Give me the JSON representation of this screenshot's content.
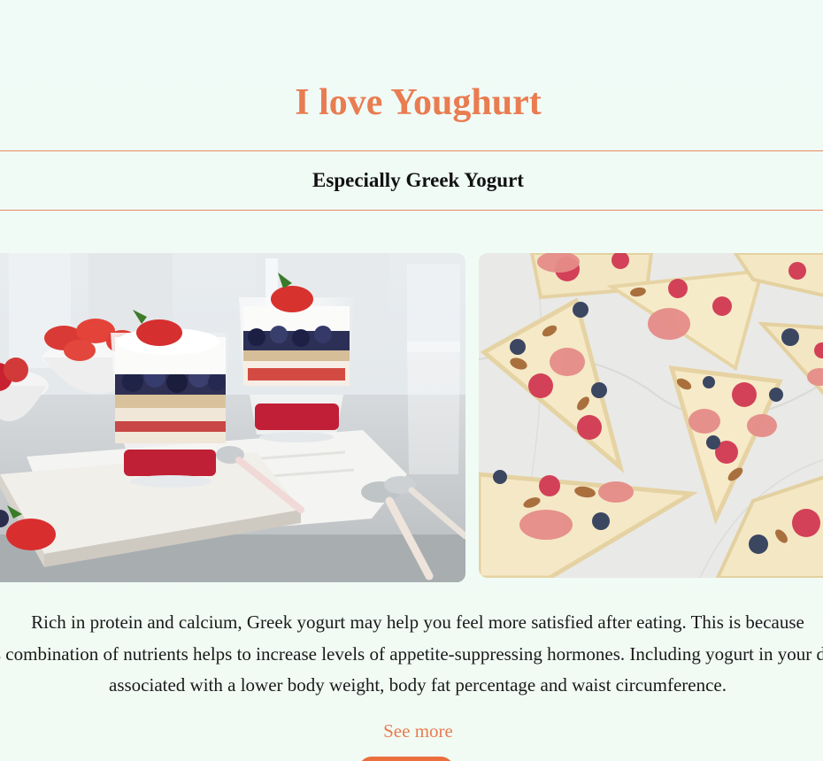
{
  "header": {
    "title": "I love Youghurt",
    "subtitle": "Especially Greek Yogurt"
  },
  "images": [
    {
      "name": "yogurt-parfait-photo",
      "alt": "Yogurt parfait glasses with berries and granola"
    },
    {
      "name": "frozen-yogurt-bark-photo",
      "alt": "Frozen yogurt bark slices with berries and almonds"
    }
  ],
  "article": {
    "lines": [
      "Rich in protein and calcium, Greek yogurt may help you feel more satisfied after eating. This is because",
      "this combination of nutrients helps to increase levels of appetite-suppressing hormones. Including yogurt in your diet is",
      "associated with a lower body weight, body fat percentage and waist circumference."
    ],
    "see_more": "See more"
  },
  "colors": {
    "accent": "#e97c50",
    "background": "#f1fbf5",
    "button": "#ea6e3e"
  }
}
